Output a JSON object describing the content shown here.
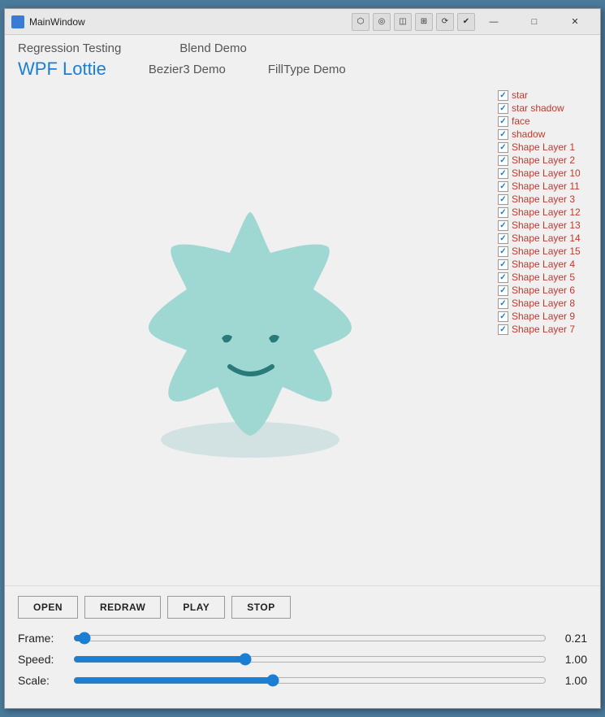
{
  "window": {
    "title": "MainWindow"
  },
  "nav": {
    "links": [
      {
        "label": "Regression Testing",
        "active": false
      },
      {
        "label": "Blend Demo",
        "active": false
      },
      {
        "label": "WPF Lottie",
        "active": true
      },
      {
        "label": "Bezier3 Demo",
        "active": false
      },
      {
        "label": "FillType Demo",
        "active": false
      }
    ]
  },
  "layers": [
    {
      "name": "star",
      "checked": true
    },
    {
      "name": "star shadow",
      "checked": true
    },
    {
      "name": "face",
      "checked": true
    },
    {
      "name": "shadow",
      "checked": true
    },
    {
      "name": "Shape Layer 1",
      "checked": true
    },
    {
      "name": "Shape Layer 2",
      "checked": true
    },
    {
      "name": "Shape Layer 10",
      "checked": true
    },
    {
      "name": "Shape Layer 11",
      "checked": true
    },
    {
      "name": "Shape Layer 3",
      "checked": true
    },
    {
      "name": "Shape Layer 12",
      "checked": true
    },
    {
      "name": "Shape Layer 13",
      "checked": true
    },
    {
      "name": "Shape Layer 14",
      "checked": true
    },
    {
      "name": "Shape Layer 15",
      "checked": true
    },
    {
      "name": "Shape Layer 4",
      "checked": true
    },
    {
      "name": "Shape Layer 5",
      "checked": true
    },
    {
      "name": "Shape Layer 6",
      "checked": true
    },
    {
      "name": "Shape Layer 8",
      "checked": true
    },
    {
      "name": "Shape Layer 9",
      "checked": true
    },
    {
      "name": "Shape Layer 7",
      "checked": true
    }
  ],
  "buttons": {
    "open": "OPEN",
    "redraw": "REDRAW",
    "play": "PLAY",
    "stop": "STOP"
  },
  "sliders": {
    "frame": {
      "label": "Frame:",
      "value": "0.21",
      "min": 0,
      "max": 100,
      "current": 0.5
    },
    "speed": {
      "label": "Speed:",
      "value": "1.00",
      "min": 0,
      "max": 100,
      "current": 36
    },
    "scale": {
      "label": "Scale:",
      "value": "1.00",
      "min": 0,
      "max": 100,
      "current": 42
    }
  },
  "titlebar_controls": {
    "minimize": "—",
    "maximize": "□",
    "close": "✕"
  }
}
